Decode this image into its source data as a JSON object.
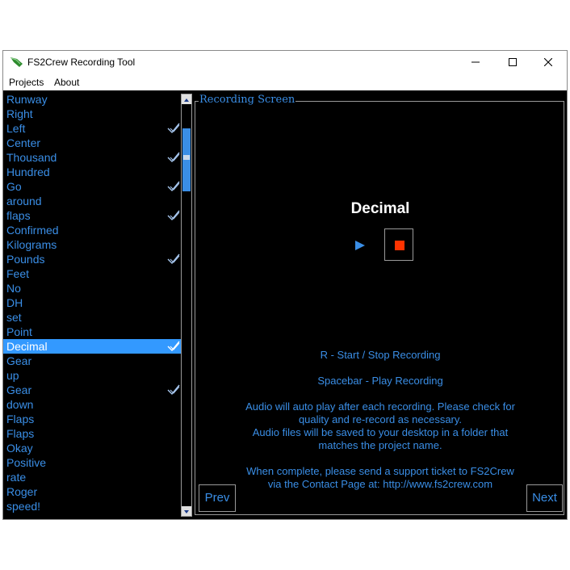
{
  "window": {
    "title": "FS2Crew Recording Tool"
  },
  "menu": {
    "projects": "Projects",
    "about": "About"
  },
  "words": [
    {
      "label": "Runway",
      "checked": false
    },
    {
      "label": "Right",
      "checked": false
    },
    {
      "label": "Left",
      "checked": true
    },
    {
      "label": "Center",
      "checked": false
    },
    {
      "label": "Thousand",
      "checked": true
    },
    {
      "label": "Hundred",
      "checked": false
    },
    {
      "label": "Go",
      "checked": true
    },
    {
      "label": "around",
      "checked": false
    },
    {
      "label": "flaps",
      "checked": true
    },
    {
      "label": "Confirmed",
      "checked": false
    },
    {
      "label": "Kilograms",
      "checked": false
    },
    {
      "label": "Pounds",
      "checked": true
    },
    {
      "label": "Feet",
      "checked": false
    },
    {
      "label": "No",
      "checked": false
    },
    {
      "label": "DH",
      "checked": false
    },
    {
      "label": "set",
      "checked": false
    },
    {
      "label": "Point",
      "checked": false
    },
    {
      "label": "Decimal",
      "checked": true,
      "selected": true
    },
    {
      "label": "Gear",
      "checked": false
    },
    {
      "label": "up",
      "checked": false
    },
    {
      "label": "Gear",
      "checked": true
    },
    {
      "label": "down",
      "checked": false
    },
    {
      "label": "Flaps",
      "checked": false
    },
    {
      "label": "Flaps",
      "checked": false
    },
    {
      "label": "Okay",
      "checked": false
    },
    {
      "label": "Positive",
      "checked": false
    },
    {
      "label": "rate",
      "checked": false
    },
    {
      "label": "Roger",
      "checked": false
    },
    {
      "label": "speed!",
      "checked": false
    }
  ],
  "recording": {
    "panel_title": "Recording Screen",
    "current_word": "Decimal",
    "instr_record": "R - Start / Stop Recording",
    "instr_play": "Spacebar - Play Recording",
    "note_lines": [
      "Audio will auto play after each recording. Please check for",
      "quality and re-record as necessary.",
      "Audio files will be saved to your desktop in a folder that",
      "matches the project name."
    ],
    "complete_lines": [
      "When complete, please send a support ticket to FS2Crew",
      "via the Contact Page at: http://www.fs2crew.com"
    ],
    "prev_label": "Prev",
    "next_label": "Next"
  },
  "colors": {
    "accent": "#3a8ee6",
    "selection": "#3399ff",
    "stop": "#ff3300",
    "background": "#000000"
  },
  "icons": [
    "app-logo-icon",
    "minimize-icon",
    "maximize-icon",
    "close-icon",
    "check-icon",
    "play-icon",
    "stop-icon",
    "scroll-up-icon",
    "scroll-down-icon"
  ]
}
